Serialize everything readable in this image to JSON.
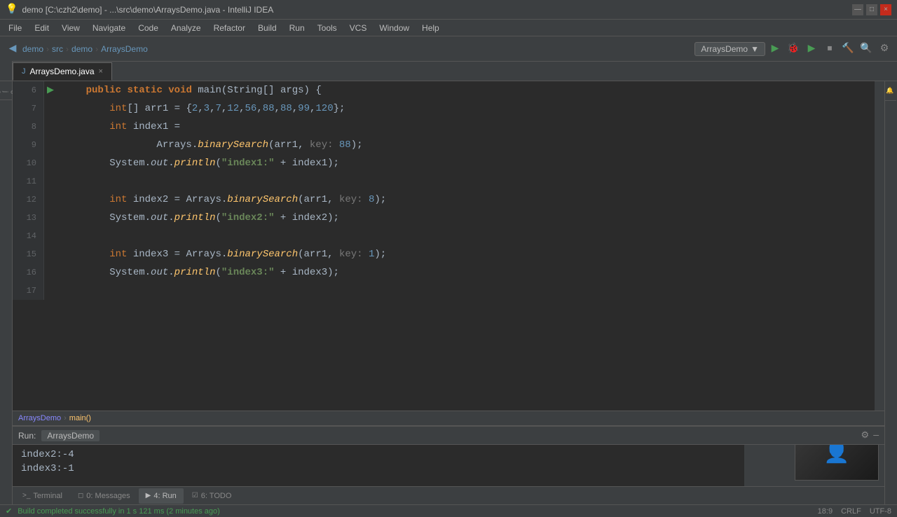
{
  "titleBar": {
    "title": "demo [C:\\czh2\\demo] - ...\\src\\demo\\ArraysDemo.java - IntelliJ IDEA",
    "controls": [
      "—",
      "□",
      "×"
    ]
  },
  "menuBar": {
    "items": [
      "File",
      "Edit",
      "View",
      "Navigate",
      "Code",
      "Analyze",
      "Refactor",
      "Build",
      "Run",
      "Tools",
      "VCS",
      "Window",
      "Help"
    ]
  },
  "toolbar": {
    "breadcrumbs": [
      "demo",
      "src",
      "demo",
      "ArraysDemo"
    ],
    "runConfig": "ArraysDemo",
    "runConfigArrow": "▼"
  },
  "tabs": [
    {
      "label": "ArraysDemo.java",
      "active": true
    }
  ],
  "codeLines": [
    {
      "number": "6",
      "hasRun": true,
      "code": "    public static void main(String[] args) {"
    },
    {
      "number": "7",
      "hasRun": false,
      "code": "        int[] arr1 = {2,3,7,12,56,88,88,99,120};"
    },
    {
      "number": "8",
      "hasRun": false,
      "code": "        int index1 ="
    },
    {
      "number": "9",
      "hasRun": false,
      "code": "                Arrays.binarySearch(arr1, key: 88);"
    },
    {
      "number": "10",
      "hasRun": false,
      "code": "        System.out.println(\"index1:\" + index1);"
    },
    {
      "number": "11",
      "hasRun": false,
      "code": ""
    },
    {
      "number": "12",
      "hasRun": false,
      "code": "        int index2 = Arrays.binarySearch(arr1, key: 8);"
    },
    {
      "number": "13",
      "hasRun": false,
      "code": "        System.out.println(\"index2:\" + index2);"
    },
    {
      "number": "14",
      "hasRun": false,
      "code": ""
    },
    {
      "number": "15",
      "hasRun": false,
      "code": "        int index3 = Arrays.binarySearch(arr1, key: 1);"
    },
    {
      "number": "16",
      "hasRun": false,
      "code": "        System.out.println(\"index3:\" + index3);"
    },
    {
      "number": "17",
      "hasRun": false,
      "code": ""
    }
  ],
  "breadcrumbBottom": {
    "class": "ArraysDemo",
    "sep": "›",
    "method": "main()"
  },
  "runPanel": {
    "label": "Run:",
    "configName": "ArraysDemo",
    "output": [
      "index2:-4",
      "index3:-1"
    ]
  },
  "bottomTabs": [
    {
      "label": "Terminal",
      "icon": ">_",
      "active": false
    },
    {
      "label": "0: Messages",
      "icon": "◻",
      "active": false
    },
    {
      "label": "4: Run",
      "icon": "▶",
      "active": true
    },
    {
      "label": "6: TODO",
      "icon": "☑",
      "active": false
    }
  ],
  "statusBar": {
    "message": "Build completed successfully in 1 s 121 ms (2 minutes ago)",
    "position": "18:9",
    "lineEnding": "CRLF",
    "encoding": "UTF-8"
  },
  "sidebarLeft": {
    "items": [
      "Project"
    ]
  },
  "sidebarRight": {
    "items": [
      "Notifications"
    ]
  }
}
